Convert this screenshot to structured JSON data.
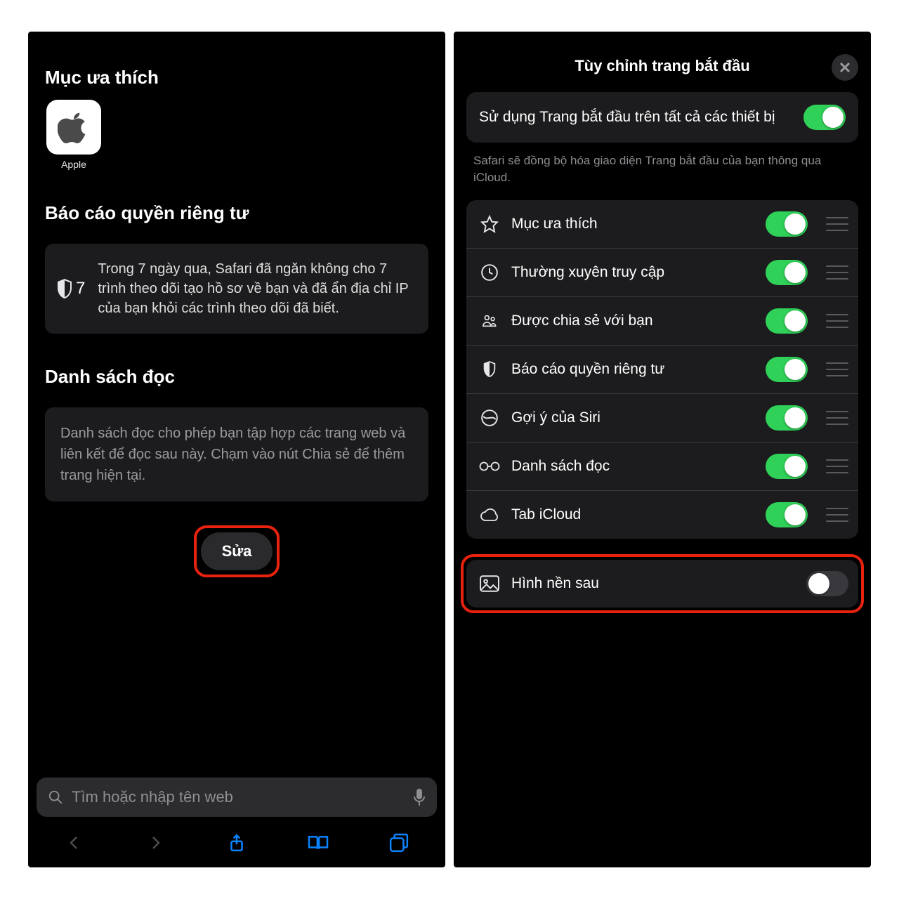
{
  "left": {
    "favorites_title": "Mục ưa thích",
    "fav_item_label": "Apple",
    "privacy_title": "Báo cáo quyền riêng tư",
    "privacy_count": "7",
    "privacy_text": "Trong 7 ngày qua, Safari đã ngăn không cho 7 trình theo dõi tạo hồ sơ về bạn và đã ẩn địa chỉ IP của bạn khỏi các trình theo dõi đã biết.",
    "reading_title": "Danh sách đọc",
    "reading_text": "Danh sách đọc cho phép bạn tập hợp các trang web và liên kết để đọc sau này. Chạm vào nút Chia sẻ để thêm trang hiện tại.",
    "edit_label": "Sửa",
    "search_placeholder": "Tìm hoặc nhập tên web"
  },
  "right": {
    "sheet_title": "Tùy chỉnh trang bắt đầu",
    "sync_label": "Sử dụng Trang bắt đầu trên tất cả các thiết bị",
    "sync_hint": "Safari sẽ đồng bộ hóa giao diện Trang bắt đầu của bạn thông qua iCloud.",
    "rows": {
      "favorites": "Mục ưa thích",
      "frequent": "Thường xuyên truy cập",
      "shared": "Được chia sẻ với bạn",
      "privacy": "Báo cáo quyền riêng tư",
      "siri": "Gợi ý của Siri",
      "reading": "Danh sách đọc",
      "icloud": "Tab iCloud"
    },
    "background_label": "Hình nền sau"
  }
}
